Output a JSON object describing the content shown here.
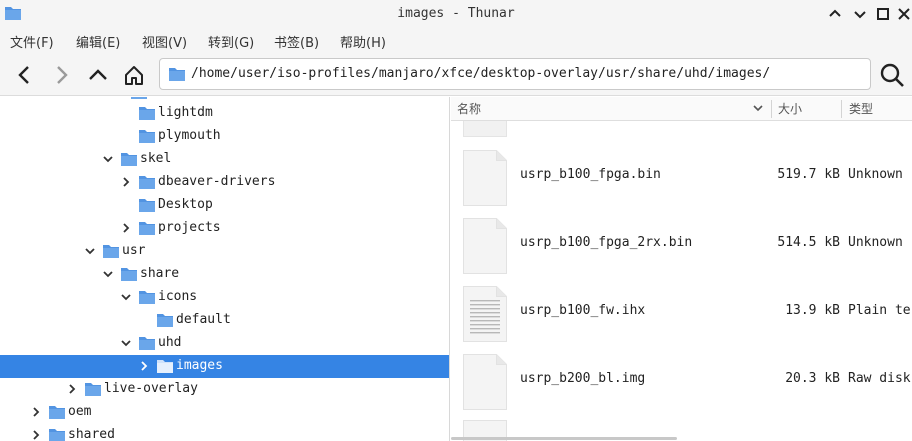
{
  "window": {
    "title": "images - Thunar"
  },
  "menu": [
    "文件(F)",
    "编辑(E)",
    "视图(V)",
    "转到(G)",
    "书签(B)",
    "帮助(H)"
  ],
  "toolbar": {
    "location_path": "/home/user/iso-profiles/manjaro/xfce/desktop-overlay/usr/share/uhd/images/"
  },
  "colors": {
    "accent": "#3584e4",
    "folder": "#5294e2"
  },
  "tree": [
    {
      "label": "lightdm",
      "expander": "none",
      "level": 7
    },
    {
      "label": "plymouth",
      "expander": "none",
      "level": 7
    },
    {
      "label": "skel",
      "expander": "expanded",
      "level": 6
    },
    {
      "label": "dbeaver-drivers",
      "expander": "collapsed",
      "level": 7
    },
    {
      "label": "Desktop",
      "expander": "none",
      "level": 7
    },
    {
      "label": "projects",
      "expander": "collapsed",
      "level": 7
    },
    {
      "label": "usr",
      "expander": "expanded",
      "level": 5
    },
    {
      "label": "share",
      "expander": "expanded",
      "level": 6
    },
    {
      "label": "icons",
      "expander": "expanded",
      "level": 7
    },
    {
      "label": "default",
      "expander": "none",
      "level": 8
    },
    {
      "label": "uhd",
      "expander": "expanded",
      "level": 7
    },
    {
      "label": "images",
      "expander": "collapsed",
      "level": 8,
      "selected": true
    },
    {
      "label": "live-overlay",
      "expander": "collapsed",
      "level": 4
    },
    {
      "label": "oem",
      "expander": "collapsed",
      "level": 2
    },
    {
      "label": "shared",
      "expander": "collapsed",
      "level": 2
    }
  ],
  "columns": {
    "name": "名称",
    "size": "大小",
    "type": "类型"
  },
  "files": [
    {
      "name": "usrp_b100_fpga.bin",
      "size": "519.7 kB",
      "type": "Unknown",
      "icon": "blank-file-icon"
    },
    {
      "name": "usrp_b100_fpga_2rx.bin",
      "size": "514.5 kB",
      "type": "Unknown",
      "icon": "blank-file-icon"
    },
    {
      "name": "usrp_b100_fw.ihx",
      "size": "13.9 kB",
      "type": "Plain te",
      "icon": "text-file-icon"
    },
    {
      "name": "usrp_b200_bl.img",
      "size": "20.3 kB",
      "type": "Raw disk",
      "icon": "blank-file-icon"
    }
  ]
}
